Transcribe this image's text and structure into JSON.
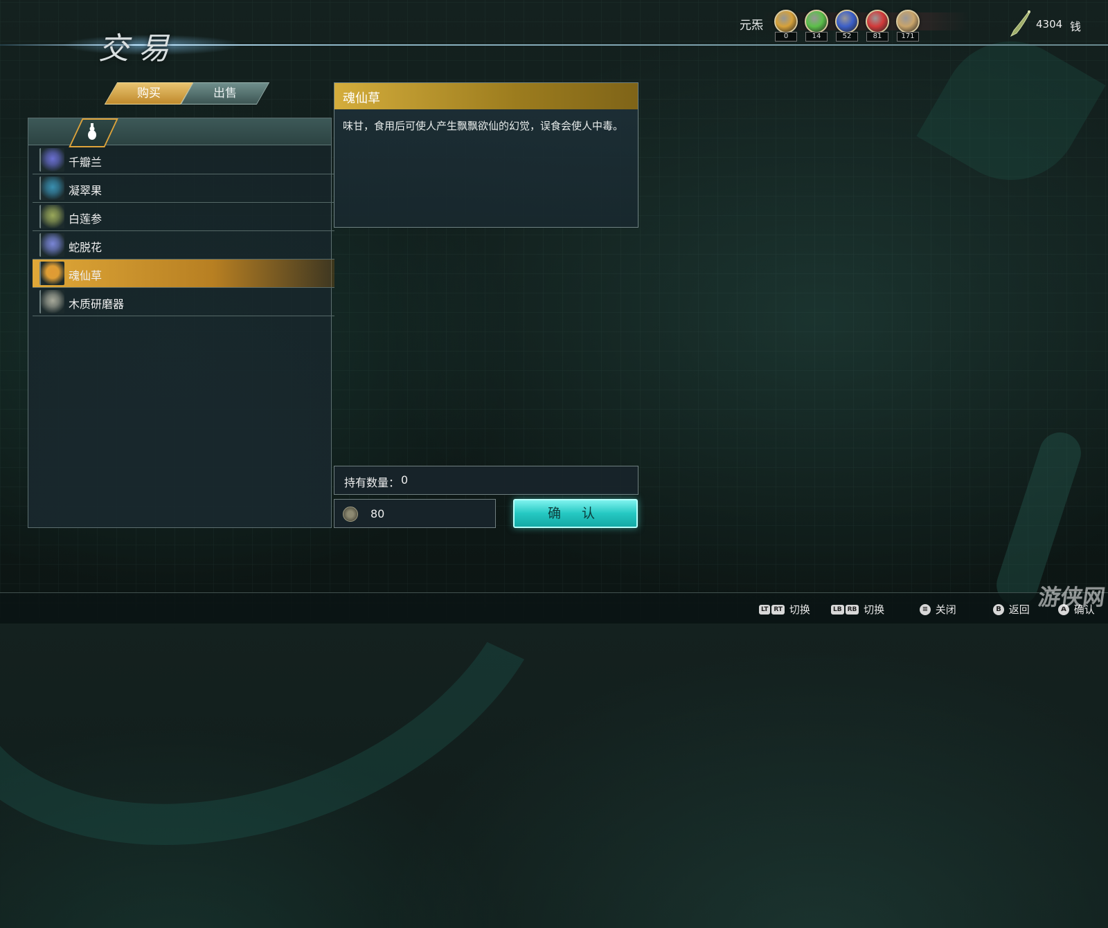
{
  "header": {
    "title": "交易",
    "elements_label": "元炁",
    "elements": [
      {
        "name": "earth-element-icon",
        "value": "0",
        "color": "#d6a13a"
      },
      {
        "name": "wood-element-icon",
        "value": "14",
        "color": "#5cbf4a"
      },
      {
        "name": "water-element-icon",
        "value": "52",
        "color": "#3c5fc8"
      },
      {
        "name": "fire-element-icon",
        "value": "81",
        "color": "#d23a3a"
      },
      {
        "name": "metal-element-icon",
        "value": "171",
        "color": "#c9a46a"
      }
    ],
    "money_value": "4304",
    "money_unit": "钱"
  },
  "tabs": {
    "buy": "购买",
    "sell": "出售"
  },
  "category": {
    "icon": "gourd-icon"
  },
  "items": [
    {
      "name": "千瓣兰",
      "icon": "orchid-icon",
      "color": "#6a6fd0"
    },
    {
      "name": "凝翠果",
      "icon": "jade-fruit-icon",
      "color": "#3a8fb0"
    },
    {
      "name": "白莲参",
      "icon": "lotus-root-icon",
      "color": "#9aa85a"
    },
    {
      "name": "蛇脱花",
      "icon": "flower-icon",
      "color": "#7a86d6"
    },
    {
      "name": "魂仙草",
      "icon": "herb-bundle-icon",
      "color": "#e09a34"
    },
    {
      "name": "木质研磨器",
      "icon": "mortar-icon",
      "color": "#a7a99a"
    }
  ],
  "selected_index": 4,
  "detail": {
    "title": "魂仙草",
    "description": "味甘，食用后可使人产生飘飘欲仙的幻觉，误食会使人中毒。"
  },
  "hold": {
    "label": "持有数量：",
    "value": "0"
  },
  "price": {
    "value": "80"
  },
  "confirm_label": "确 认",
  "hints": [
    {
      "keys": [
        "LT",
        "RT"
      ],
      "label": "切换",
      "type": "rect"
    },
    {
      "keys": [
        "LB",
        "RB"
      ],
      "label": "切换",
      "type": "rect"
    },
    {
      "keys": [
        "≡"
      ],
      "label": "关闭",
      "type": "circle"
    },
    {
      "keys": [
        "B"
      ],
      "label": "返回",
      "type": "circle"
    },
    {
      "keys": [
        "A"
      ],
      "label": "确认",
      "type": "circle"
    }
  ],
  "watermark": "游侠网"
}
